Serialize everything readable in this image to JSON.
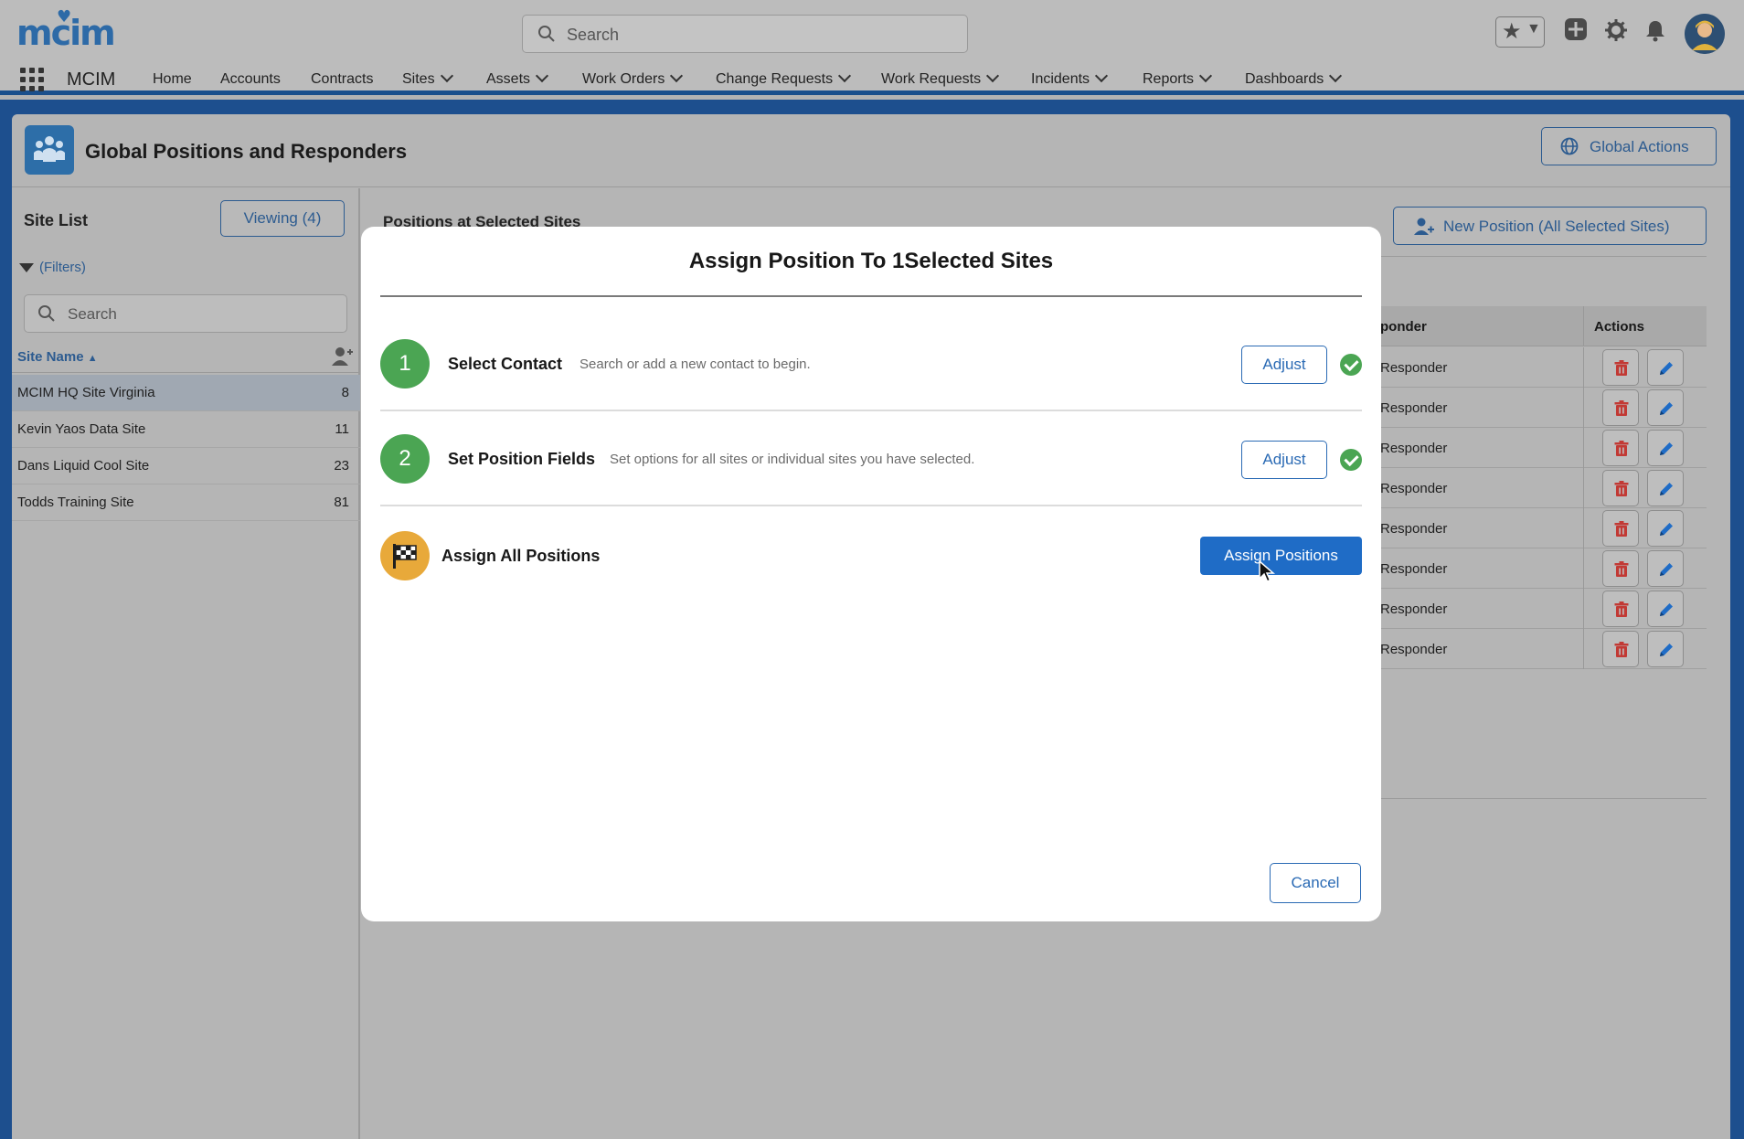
{
  "header": {
    "logo_text": "mcim",
    "search_placeholder": "Search",
    "app_name": "MCIM",
    "nav": [
      {
        "label": "Home",
        "has_menu": false
      },
      {
        "label": "Accounts",
        "has_menu": false
      },
      {
        "label": "Contracts",
        "has_menu": false
      },
      {
        "label": "Sites",
        "has_menu": true
      },
      {
        "label": "Assets",
        "has_menu": true
      },
      {
        "label": "Work Orders",
        "has_menu": true
      },
      {
        "label": "Change Requests",
        "has_menu": true
      },
      {
        "label": "Work Requests",
        "has_menu": true
      },
      {
        "label": "Incidents",
        "has_menu": true
      },
      {
        "label": "Reports",
        "has_menu": true
      },
      {
        "label": "Dashboards",
        "has_menu": true
      }
    ],
    "icons": [
      "favorites-star-icon",
      "favorites-dropdown-icon",
      "add-icon",
      "setup-gear-icon",
      "notifications-bell-icon",
      "user-avatar"
    ]
  },
  "page": {
    "title": "Global Positions and Responders",
    "global_actions_label": "Global Actions"
  },
  "site_list": {
    "title": "Site List",
    "viewing_label": "Viewing (4)",
    "filters_label": "(Filters)",
    "search_placeholder": "Search",
    "column_label": "Site Name",
    "sites": [
      {
        "name": "MCIM HQ Site Virginia",
        "count": "8",
        "selected": true
      },
      {
        "name": "Kevin Yaos Data Site",
        "count": "11",
        "selected": false
      },
      {
        "name": "Dans Liquid Cool Site",
        "count": "23",
        "selected": false
      },
      {
        "name": "Todds Training Site",
        "count": "81",
        "selected": false
      }
    ]
  },
  "positions": {
    "title": "Positions at Selected Sites",
    "new_position_label": "New Position (All Selected Sites)",
    "columns": [
      "ponder",
      "Actions"
    ],
    "rows": [
      "Responder",
      "Responder",
      "Responder",
      "Responder",
      "Responder",
      "Responder",
      "Responder",
      "Responder"
    ]
  },
  "modal": {
    "title": "Assign Position To 1Selected Sites",
    "steps": [
      {
        "number": "1",
        "name": "Select Contact",
        "description": "Search or add a new contact to begin.",
        "button": "Adjust",
        "complete": true
      },
      {
        "number": "2",
        "name": "Set Position Fields",
        "description": "Set options for all sites or individual sites you have selected.",
        "button": "Adjust",
        "complete": true
      }
    ],
    "final_step": {
      "name": "Assign All Positions",
      "button": "Assign Positions"
    },
    "cancel_label": "Cancel"
  },
  "colors": {
    "brand_blue": "#1f6cc6",
    "success_green": "#4ba553",
    "final_step_gold": "#e8a93a",
    "delete_red": "#c23934"
  }
}
